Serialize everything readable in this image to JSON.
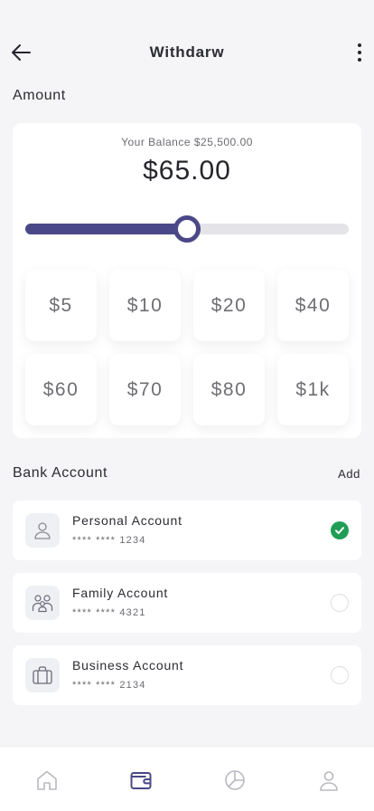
{
  "header": {
    "title": "Withdarw"
  },
  "amount_section": {
    "label": "Amount",
    "balance_label": "Your Balance $25,500.00",
    "amount": "$65.00",
    "slider_fraction": 0.5,
    "chips": [
      "$5",
      "$10",
      "$20",
      "$40",
      "$60",
      "$70",
      "$80",
      "$1k"
    ]
  },
  "bank_section": {
    "label": "Bank Account",
    "add_label": "Add",
    "accounts": [
      {
        "name": "Personal Account",
        "number": "**** **** 1234",
        "icon": "user-icon",
        "selected": true
      },
      {
        "name": "Family Account",
        "number": "**** **** 4321",
        "icon": "family-icon",
        "selected": false
      },
      {
        "name": "Business Account",
        "number": "**** **** 2134",
        "icon": "briefcase-icon",
        "selected": false
      }
    ]
  },
  "bottom_nav": {
    "items": [
      {
        "icon": "home-icon",
        "active": false
      },
      {
        "icon": "wallet-icon",
        "active": true
      },
      {
        "icon": "pie-chart-icon",
        "active": false
      },
      {
        "icon": "profile-icon",
        "active": false
      }
    ]
  },
  "colors": {
    "accent": "#4a4886",
    "success": "#1f9d55",
    "inactive_icon": "#b8b8c0"
  }
}
